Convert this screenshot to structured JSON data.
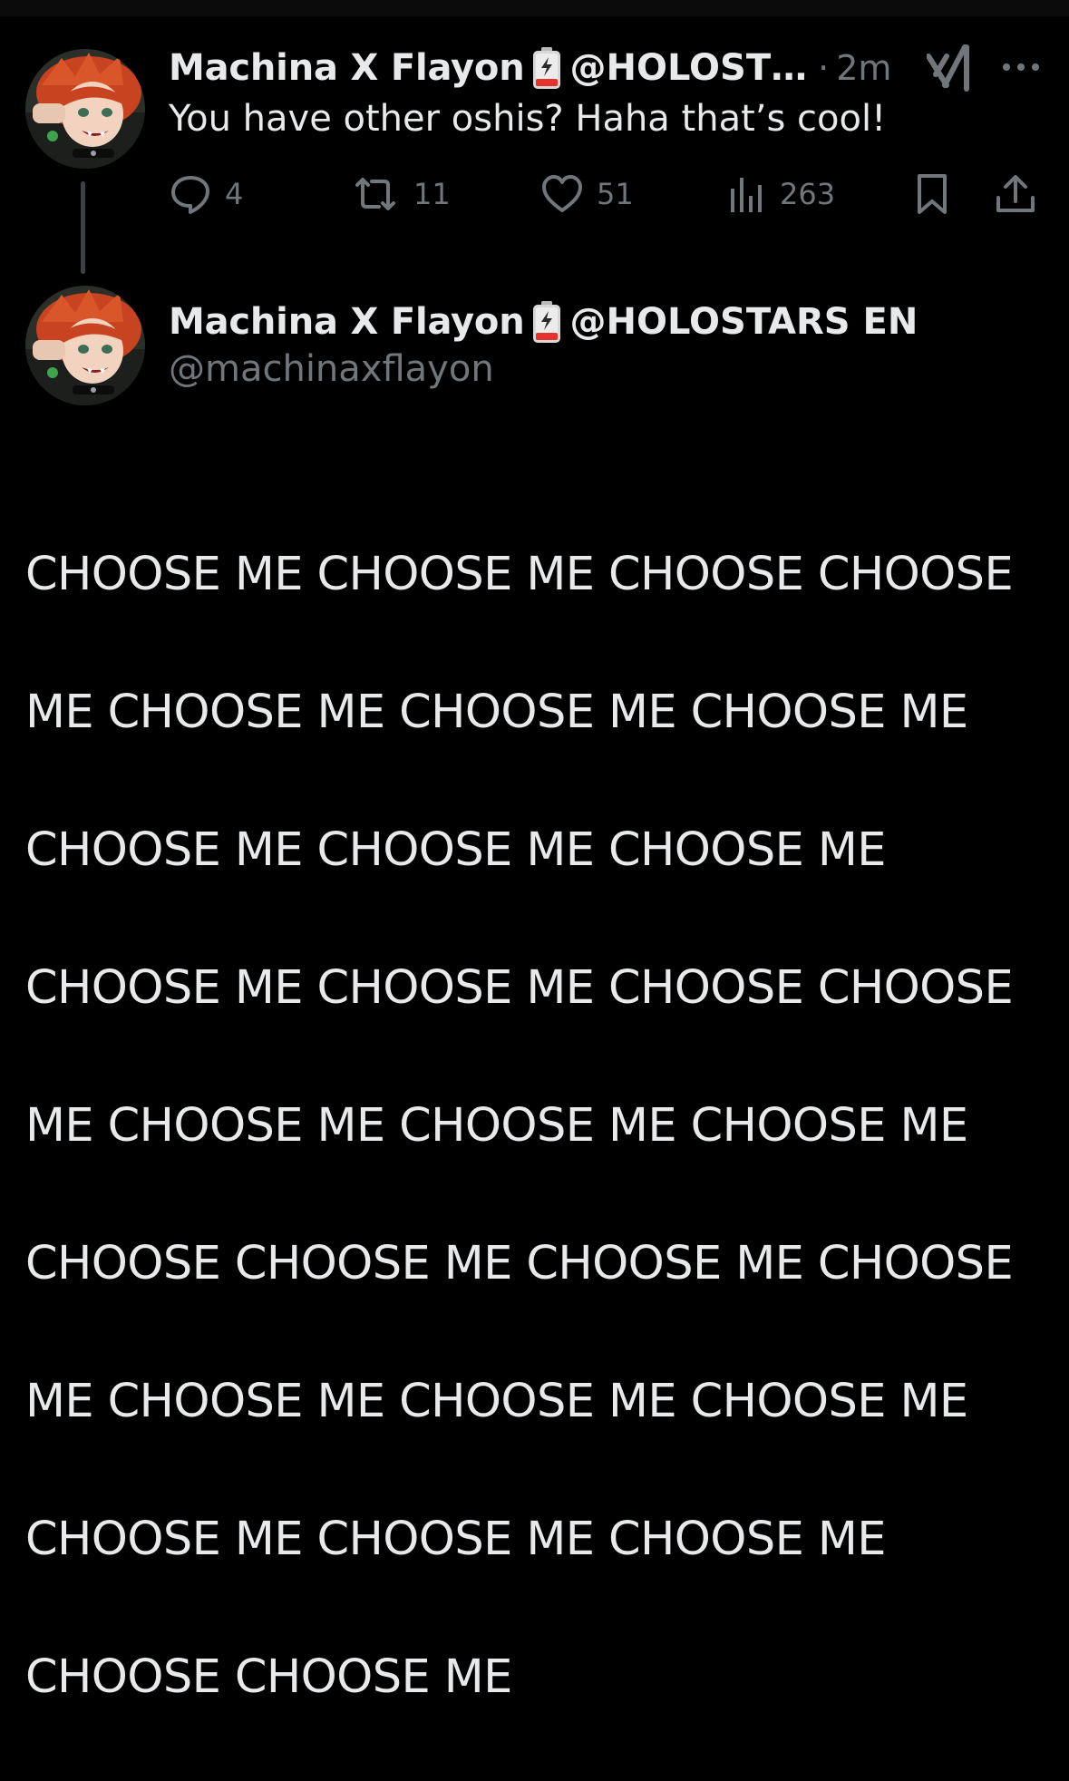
{
  "tweet1": {
    "display_name": "Machina X Flayon",
    "handle_truncated": "@HOLOST…",
    "separator": "·",
    "time": "2m",
    "text": "You have other oshis? Haha that’s cool!",
    "stats": {
      "replies": "4",
      "retweets": "11",
      "likes": "51",
      "views": "263"
    }
  },
  "tweet2": {
    "display_name": "Machina X Flayon",
    "affiliation": "@HOLOSTARS EN",
    "handle": "@machinaxflayon",
    "lines": [
      "CHOOSE ME CHOOSE ME CHOOSE CHOOSE",
      "ME CHOOSE ME CHOOSE ME CHOOSE ME",
      "CHOOSE ME CHOOSE ME CHOOSE ME",
      "CHOOSE ME CHOOSE ME CHOOSE CHOOSE",
      "ME CHOOSE ME CHOOSE ME CHOOSE ME",
      "CHOOSE CHOOSE ME CHOOSE ME CHOOSE",
      "ME CHOOSE ME CHOOSE ME CHOOSE ME",
      "CHOOSE ME CHOOSE ME CHOOSE ME",
      "CHOOSE CHOOSE ME"
    ]
  },
  "icons": {
    "battery": "battery-emoji-icon",
    "grok": "grok-icon",
    "more": "more-options-icon",
    "reply": "reply-icon",
    "retweet": "retweet-icon",
    "like": "heart-icon",
    "views": "views-icon",
    "bookmark": "bookmark-icon",
    "share": "share-icon"
  },
  "colors": {
    "background": "#000000",
    "primary_text": "#e7e9ea",
    "secondary_text": "#71767b",
    "thread_line": "#3e4144"
  }
}
